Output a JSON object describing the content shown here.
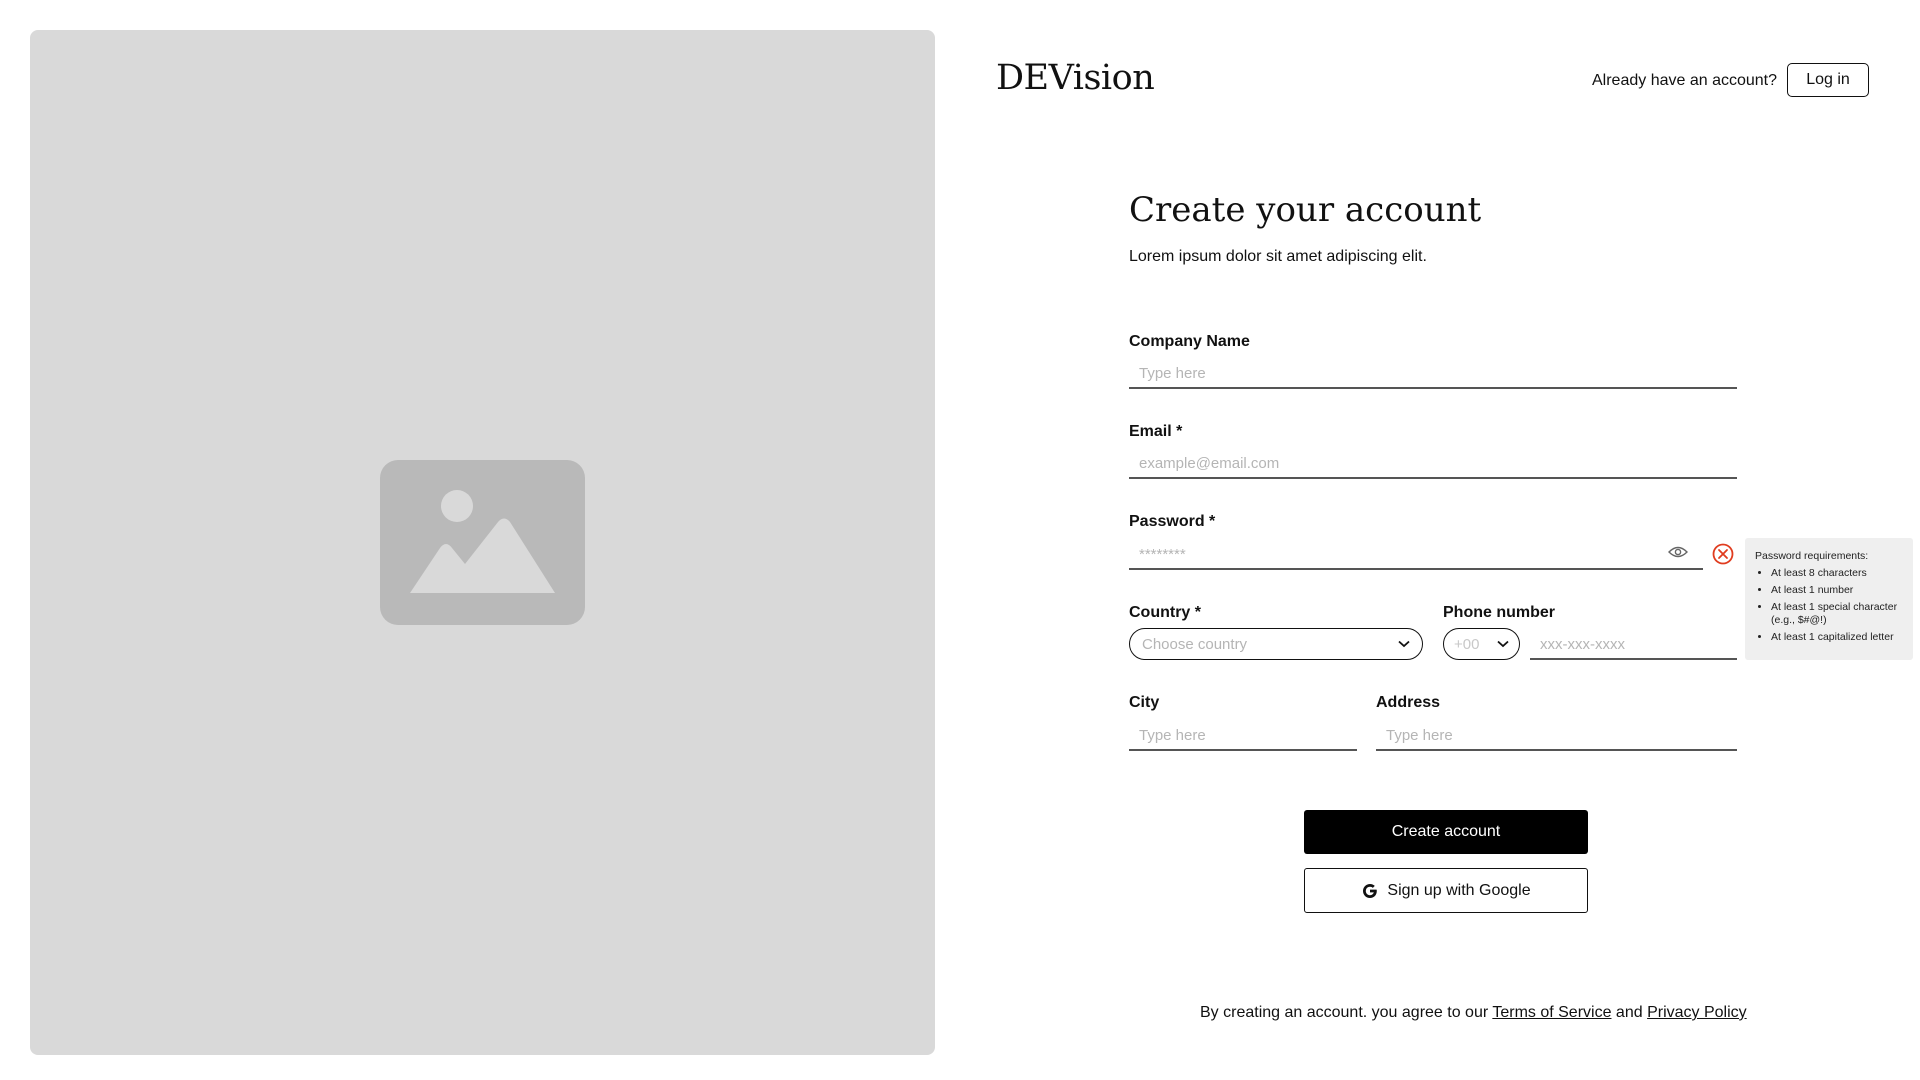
{
  "brand": {
    "logo_text": "DEVision"
  },
  "header": {
    "have_account": "Already have an account?",
    "login_label": "Log in"
  },
  "main": {
    "title": "Create your account",
    "subtitle": "Lorem ipsum dolor sit amet adipiscing elit."
  },
  "form": {
    "company": {
      "label": "Company Name",
      "placeholder": "Type here"
    },
    "email": {
      "label": "Email *",
      "placeholder": "example@email.com"
    },
    "password": {
      "label": "Password *",
      "placeholder": "********",
      "requirements_title": "Password requirements:",
      "requirements": [
        "At least 8 characters",
        "At least 1 number",
        "At least 1 special character (e.g., $#@!)",
        "At least 1 capitalized letter"
      ]
    },
    "country": {
      "label": "Country *",
      "placeholder": "Choose country"
    },
    "phone": {
      "label": "Phone number",
      "code_placeholder": "+00",
      "placeholder": "xxx-xxx-xxxx"
    },
    "city": {
      "label": "City",
      "placeholder": "Type here"
    },
    "address": {
      "label": "Address",
      "placeholder": "Type here"
    }
  },
  "actions": {
    "create_label": "Create account",
    "google_label": "Sign up with Google"
  },
  "footer": {
    "prefix": "By creating an account. you agree to our ",
    "terms": "Terms of Service",
    "and": " and ",
    "privacy": "Privacy Policy"
  },
  "icons": {
    "hero": "image-placeholder-icon",
    "eye": "eye-icon",
    "error": "error-circle-icon",
    "chevron": "chevron-down-icon",
    "google": "google-icon"
  },
  "colors": {
    "accent": "#000000",
    "error": "#e03c1f",
    "placeholder_bg": "#d9d9d9"
  }
}
